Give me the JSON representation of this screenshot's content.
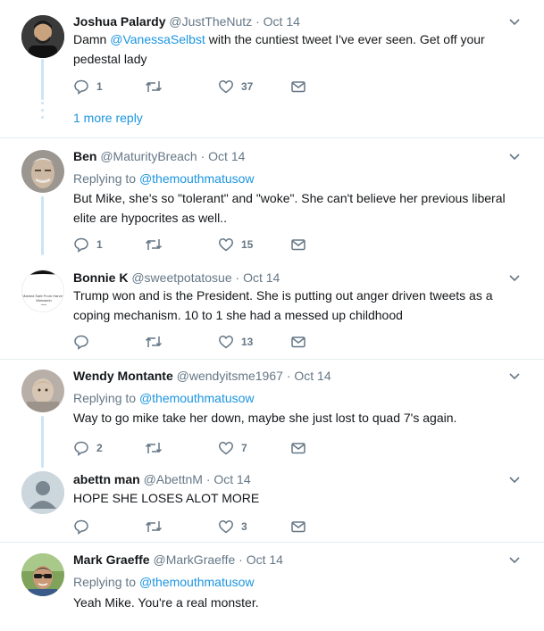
{
  "tweets": [
    {
      "name": "Joshua Palardy",
      "handle": "@JustTheNutz",
      "time": "· Oct 14",
      "replying_to": "",
      "text_before": "Damn ",
      "mention": "@VanessaSelbst",
      "text_after": "  with the cuntiest tweet I've ever seen. Get off your pedestal lady",
      "replies": "1",
      "retweets": "",
      "likes": "37"
    },
    {
      "name": "Ben",
      "handle": "@MaturityBreach",
      "time": "· Oct 14",
      "replying_label": "Replying to ",
      "replying_to": "@themouthmatusow",
      "text": "But Mike, she's so \"tolerant\" and \"woke\". She can't believe her previous liberal elite are hypocrites as well..",
      "replies": "1",
      "retweets": "",
      "likes": "15"
    },
    {
      "name": "Bonnie K",
      "handle": "@sweetpotatosue",
      "time": "· Oct 14",
      "text": "Trump won and is the President. She is putting out anger driven tweets as a coping mechanism. 10 to 1 she had a messed up childhood",
      "replies": "",
      "retweets": "",
      "likes": "13",
      "avatar_text": "Marked Safe From Harvey Weinstein"
    },
    {
      "name": "Wendy Montante",
      "handle": "@wendyitsme1967",
      "time": "· Oct 14",
      "replying_label": "Replying to ",
      "replying_to": "@themouthmatusow",
      "text": "Way to go mike take her down, maybe she just lost to quad 7's again.",
      "replies": "2",
      "retweets": "",
      "likes": "7"
    },
    {
      "name": "abettn man",
      "handle": "@AbettnM",
      "time": "· Oct 14",
      "text": "HOPE SHE LOSES ALOT MORE",
      "replies": "",
      "retweets": "",
      "likes": "3"
    },
    {
      "name": "Mark Graeffe",
      "handle": "@MarkGraeffe",
      "time": "· Oct 14",
      "replying_label": "Replying to ",
      "replying_to": "@themouthmatusow",
      "text": "Yeah Mike. You're a real monster."
    }
  ],
  "more_replies": "1 more reply",
  "colors": {
    "link": "#1b95e0",
    "secondary": "#657786",
    "thread_line": "#cce4f5",
    "divider": "#e6ecf0"
  },
  "icons": [
    "reply-icon",
    "retweet-icon",
    "like-icon",
    "message-icon",
    "chevron-down-icon"
  ]
}
